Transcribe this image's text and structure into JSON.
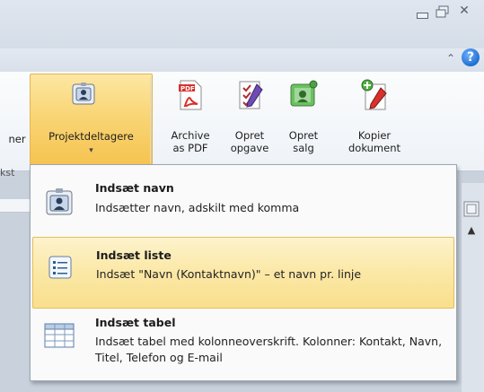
{
  "ribbon": {
    "partial_left_label": "ner",
    "partial_group_label": "kst",
    "buttons": {
      "projektdeltagere": "Projektdeltagere",
      "archive": [
        "Archive",
        "as PDF"
      ],
      "opgave": [
        "Opret",
        "opgave"
      ],
      "salg": [
        "Opret",
        "salg"
      ],
      "kopier": [
        "Kopier",
        "dokument"
      ]
    },
    "dropdown_arrow": "▾"
  },
  "window_controls": {
    "close_glyph": "✕",
    "help_glyph": "?",
    "collapse_glyph": "⌃"
  },
  "menu": {
    "items": [
      {
        "title": "Indsæt navn",
        "desc": "Indsætter navn, adskilt med komma",
        "icon": "contact-card-icon"
      },
      {
        "title": "Indsæt liste",
        "desc": "Indsæt \"Navn (Kontaktnavn)\" – et navn pr. linje",
        "icon": "list-icon",
        "highlighted": true
      },
      {
        "title": "Indsæt tabel",
        "desc": "Indsæt tabel med kolonneoverskrift. Kolonner: Kontakt, Navn, Titel, Telefon og E-mail",
        "icon": "table-icon"
      }
    ]
  },
  "colors": {
    "highlight": "#f9df8c",
    "help_blue": "#1f6fd1",
    "pdf_red": "#d8312b",
    "salg_green": "#4f9f48"
  }
}
